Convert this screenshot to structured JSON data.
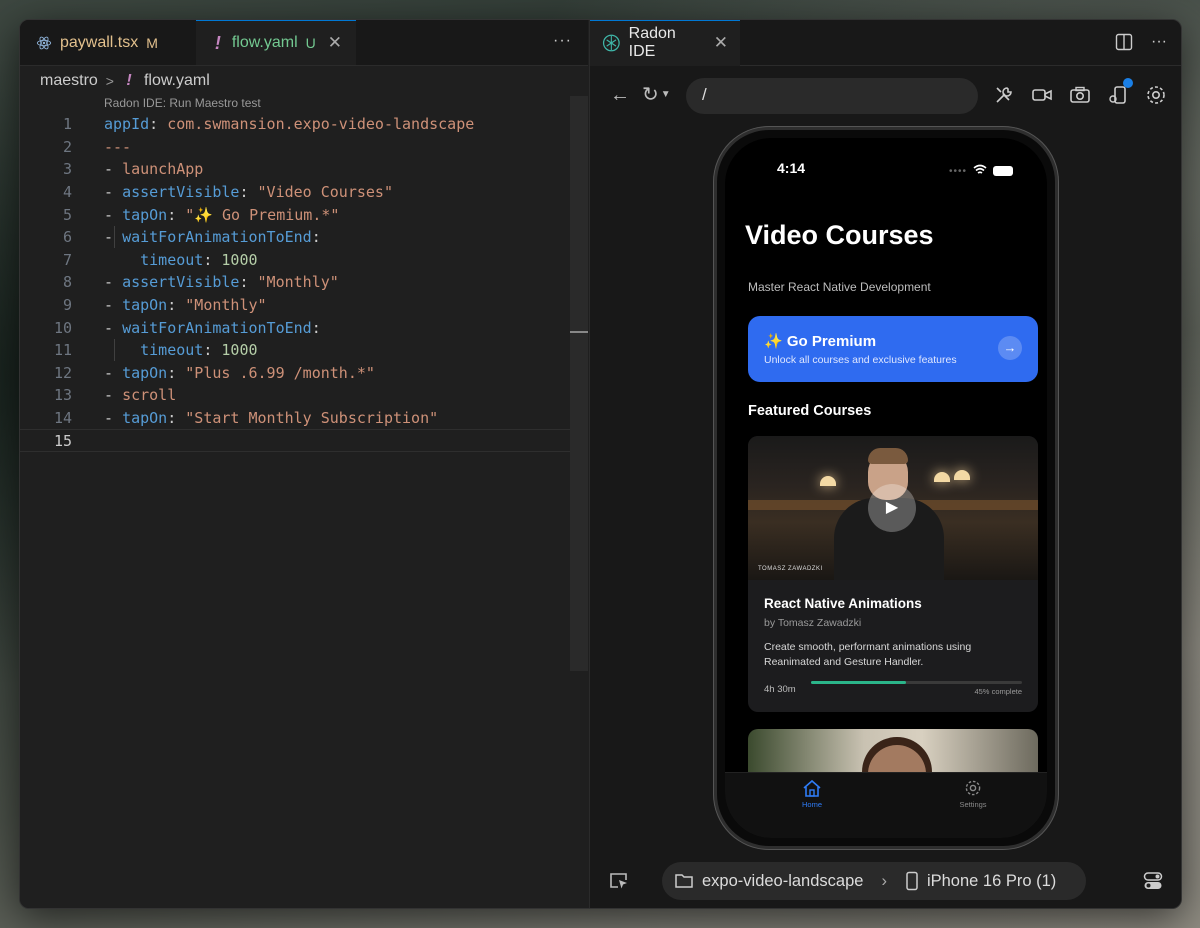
{
  "editor": {
    "tabs": [
      {
        "name": "paywall.tsx",
        "status": "M",
        "icon": "react-icon"
      },
      {
        "name": "flow.yaml",
        "status": "U",
        "icon": "yaml-exclamation-icon"
      }
    ],
    "breadcrumb": {
      "folder": "maestro",
      "file": "flow.yaml"
    },
    "codelens": "Radon IDE: Run Maestro test",
    "lines": [
      {
        "n": "1"
      },
      {
        "n": "2"
      },
      {
        "n": "3"
      },
      {
        "n": "4"
      },
      {
        "n": "5"
      },
      {
        "n": "6"
      },
      {
        "n": "7"
      },
      {
        "n": "8"
      },
      {
        "n": "9"
      },
      {
        "n": "10"
      },
      {
        "n": "11"
      },
      {
        "n": "12"
      },
      {
        "n": "13"
      },
      {
        "n": "14"
      },
      {
        "n": "15"
      }
    ],
    "code": {
      "l1_key": "appId",
      "l1_val": "com.swmansion.expo-video-landscape",
      "l2": "---",
      "l3": "launchApp",
      "l4_key": "assertVisible",
      "l4_val": "\"Video Courses\"",
      "l5_key": "tapOn",
      "l5_val": "\"✨ Go Premium.*\"",
      "l6_key": "waitForAnimationToEnd",
      "l7_key": "timeout",
      "l7_val": "1000",
      "l8_key": "assertVisible",
      "l8_val": "\"Monthly\"",
      "l9_key": "tapOn",
      "l9_val": "\"Monthly\"",
      "l10_key": "waitForAnimationToEnd",
      "l11_key": "timeout",
      "l11_val": "1000",
      "l12_key": "tapOn",
      "l12_val": "\"Plus .6.99 /month.*\"",
      "l13": "scroll",
      "l14_key": "tapOn",
      "l14_val": "\"Start Monthly Subscription\""
    }
  },
  "radon": {
    "tab_title": "Radon IDE",
    "url": "/",
    "device": {
      "project": "expo-video-landscape",
      "name": "iPhone 16 Pro (1)"
    }
  },
  "app": {
    "time": "4:14",
    "title": "Video Courses",
    "subtitle": "Master React Native Development",
    "premium_title": "✨ Go Premium",
    "premium_sub": "Unlock all courses and exclusive features",
    "featured": "Featured Courses",
    "course": {
      "title": "React Native Animations",
      "author": "by Tomasz Zawadzki",
      "description": "Create smooth, performant animations using Reanimated and Gesture Handler.",
      "duration": "4h 30m",
      "progress": 0.45,
      "progress_label": "45% complete",
      "thumb_caption": "TOMASZ ZAWADZKI"
    },
    "nav": {
      "home": "Home",
      "settings": "Settings"
    }
  },
  "colors": {
    "accent": "#2f6bf0",
    "progress": "#2bb58a",
    "tab_accent": "#0078d4"
  }
}
